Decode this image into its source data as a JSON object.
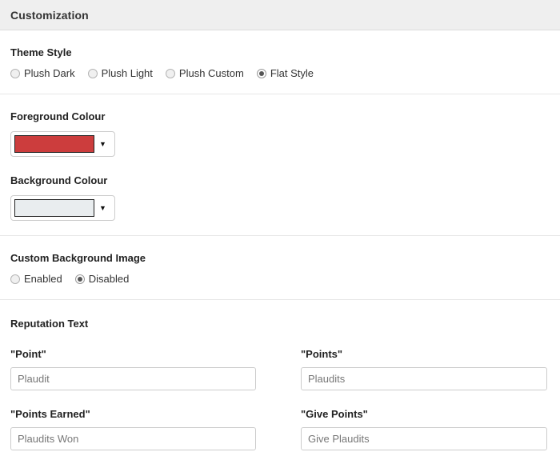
{
  "header": {
    "title": "Customization"
  },
  "sections": {
    "theme_style": {
      "label": "Theme Style",
      "options": [
        {
          "label": "Plush Dark",
          "selected": false
        },
        {
          "label": "Plush Light",
          "selected": false
        },
        {
          "label": "Plush Custom",
          "selected": false
        },
        {
          "label": "Flat Style",
          "selected": true
        }
      ]
    },
    "foreground_colour": {
      "label": "Foreground Colour",
      "value": "#cc3d3d",
      "caret": "▼"
    },
    "background_colour": {
      "label": "Background Colour",
      "value": "#e9edef",
      "caret": "▼"
    },
    "custom_background_image": {
      "label": "Custom Background Image",
      "options": [
        {
          "label": "Enabled",
          "selected": false
        },
        {
          "label": "Disabled",
          "selected": true
        }
      ]
    },
    "reputation_text": {
      "label": "Reputation Text",
      "fields": [
        {
          "label": "\"Point\"",
          "value": "Plaudit",
          "placeholder": "Plaudit"
        },
        {
          "label": "\"Points\"",
          "value": "Plaudits",
          "placeholder": "Plaudits"
        },
        {
          "label": "\"Points Earned\"",
          "value": "Plaudits Won",
          "placeholder": "Plaudits Won"
        },
        {
          "label": "\"Give Points\"",
          "value": "Give Plaudits",
          "placeholder": "Give Plaudits"
        }
      ]
    }
  }
}
